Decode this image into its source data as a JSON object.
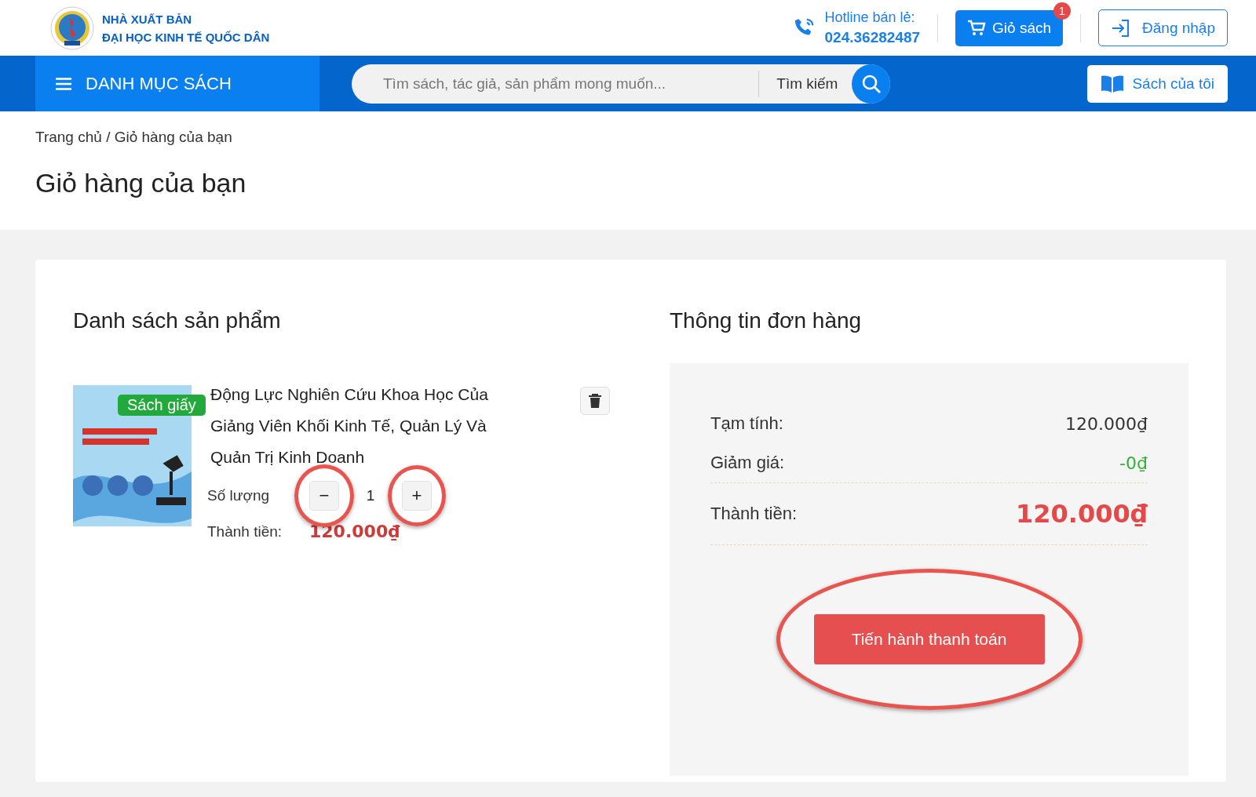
{
  "header": {
    "publisher_line_1": "NHÀ XUẤT BẢN",
    "publisher_line_2": "ĐẠI HỌC KINH TẾ QUỐC DÂN",
    "hotline_label": "Hotline bán lẻ:",
    "hotline_number": "024.36282487",
    "cart_button": "Giỏ sách",
    "cart_count": "1",
    "login_button": "Đăng nhập"
  },
  "navbar": {
    "category_menu": "DANH MỤC SÁCH",
    "search": {
      "placeholder": "Tìm sách, tác giả, sản phẩm mong muốn...",
      "button": "Tìm kiếm"
    },
    "my_books_button": "Sách của tôi"
  },
  "breadcrumb": {
    "separator": "/",
    "links": [
      "Trang chủ",
      "Giỏ hàng của bạn"
    ]
  },
  "page_title": "Giỏ hàng của bạn",
  "products": {
    "heading": "Danh sách sản phẩm",
    "items": [
      {
        "badge": "Sách giấy",
        "title": "Động Lực Nghiên Cứu Khoa Học Của Giảng Viên Khối Kinh Tế, Quản Lý Và Quản Trị Kinh Doanh",
        "quantity_label": "Số lượng",
        "quantity": "1",
        "minus": "−",
        "plus": "+",
        "minus_highlighted": true,
        "plus_highlighted": true,
        "subtotal_label": "Thành tiền:",
        "subtotal": "120.000₫"
      }
    ]
  },
  "order": {
    "heading": "Thông tin đơn hàng",
    "rows": [
      {
        "label": "Tạm tính:",
        "value": "120.000₫",
        "kind": "plain"
      },
      {
        "label": "Giảm giá:",
        "value": "-0₫",
        "kind": "discount"
      },
      {
        "label": "Thành tiền:",
        "value": "120.000₫",
        "kind": "total"
      }
    ],
    "checkout_button": "Tiến hành thanh toán",
    "checkout_highlighted": true
  }
}
